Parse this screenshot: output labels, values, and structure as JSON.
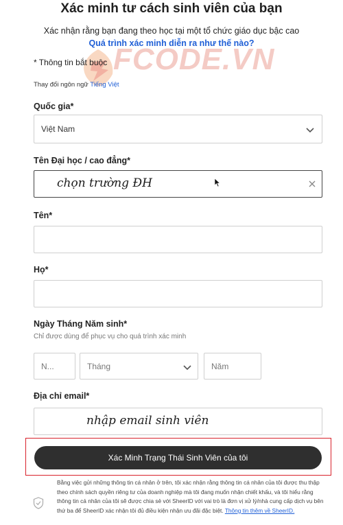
{
  "header": {
    "title": "Xác minh tư cách sinh viên của bạn",
    "subtitle": "Xác nhận rằng bạn đang theo học tại một tổ chức giáo dục bậc cao",
    "how_link": "Quá trình xác minh diễn ra như thế nào?"
  },
  "watermark": "FCODE.VN",
  "form": {
    "required_note": "* Thông tin bắt buộc",
    "language_prefix": "Thay đổi ngôn ngữ",
    "language_value": "Tiếng Việt",
    "country_label": "Quốc gia*",
    "country_value": "Việt Nam",
    "university_label": "Tên Đại học / cao đẳng*",
    "university_annotation": "chọn trường ĐH",
    "first_name_label": "Tên*",
    "last_name_label": "Họ*",
    "dob_label": "Ngày Tháng Năm sinh*",
    "dob_hint": "Chỉ được dùng để phục vụ cho quá trình xác minh",
    "dob_day_placeholder": "N...",
    "dob_month_placeholder": "Tháng",
    "dob_year_placeholder": "Năm",
    "email_label": "Địa chỉ email*",
    "email_annotation": "nhập email sinh viên",
    "submit_label": "Xác Minh Trạng Thái Sinh Viên của tôi",
    "consent_text": "Bằng việc gửi những thông tin cá nhân ở trên, tôi xác nhận rằng thông tin cá nhân của tôi được thu thập theo chính sách quyền riêng tư của doanh nghiệp mà tôi đang muốn nhận chiết khấu, và tôi hiểu rằng thông tin cá nhân của tôi sẽ được chia sẻ với SheerID với vai trò là đơn vị xử lý/nhà cung cấp dịch vụ bên thứ ba để SheerID xác nhận tôi đủ điều kiện nhận ưu đãi đặc biệt.",
    "consent_link": "Thông tin thêm về SheerID."
  },
  "colors": {
    "link": "#1f5fd6",
    "highlight_box": "#d8202a",
    "button": "#2f2f2f"
  }
}
